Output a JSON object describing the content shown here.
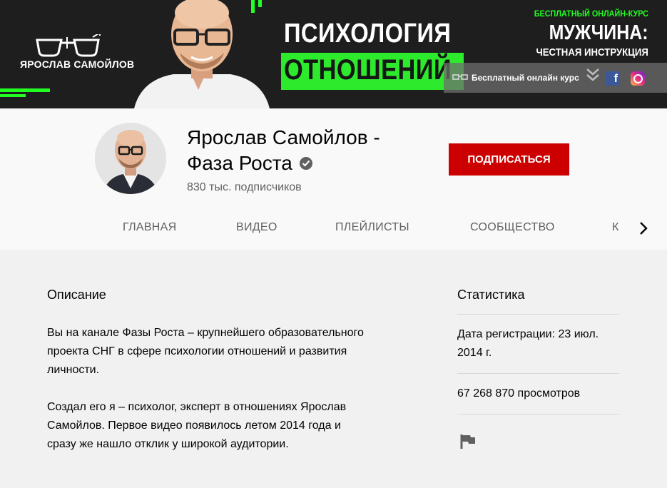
{
  "banner": {
    "logo_name": "ЯРОСЛАВ САМОЙЛОВ",
    "title_line1": "ПСИХОЛОГИЯ",
    "title_line2": "ОТНОШЕНИЙ",
    "promo_tag": "БЕСПЛАТНЫЙ ОНЛАЙН-КУРС",
    "promo_title": "МУЖЧИНА:",
    "promo_subtitle": "ЧЕСТНАЯ ИНСТРУКЦИЯ",
    "overlay_link": "Бесплатный онлайн курс",
    "accent_color": "#22ff22"
  },
  "channel": {
    "name": "Ярослав Самойлов - Фаза Роста",
    "subscribers": "830 тыс. подписчиков",
    "subscribe_label": "ПОДПИСАТЬСЯ"
  },
  "tabs": [
    {
      "label": "ГЛАВНАЯ"
    },
    {
      "label": "ВИДЕО"
    },
    {
      "label": "ПЛЕЙЛИСТЫ"
    },
    {
      "label": "СООБЩЕСТВО"
    },
    {
      "label": "К"
    }
  ],
  "about": {
    "description_title": "Описание",
    "paragraphs": [
      "Вы на канале Фазы Роста – крупнейшего образовательного проекта СНГ в сфере психологии отношений и развития личности.",
      "Создал его я – психолог, эксперт в отношениях Ярослав Самойлов. Первое видео появилось летом 2014 года и сразу же нашло отклик у широкой аудитории."
    ],
    "stats_title": "Статистика",
    "registration": "Дата регистрации: 23 июл. 2014 г.",
    "views": "67 268 870 просмотров"
  },
  "icons": [
    "glasses-logo-icon",
    "chevron-double-down-icon",
    "facebook-icon",
    "instagram-icon",
    "verified-icon",
    "chevron-right-icon",
    "flag-icon"
  ]
}
